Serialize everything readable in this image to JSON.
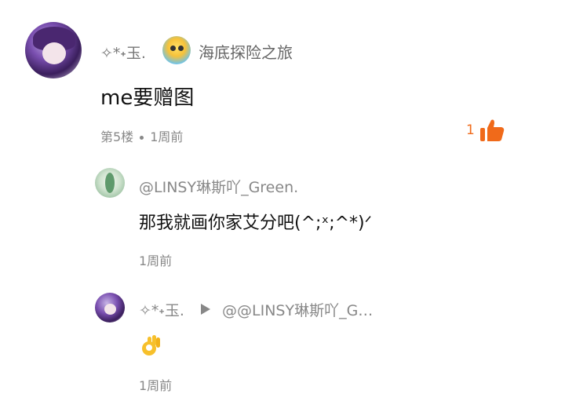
{
  "comment": {
    "author": "✧*˖玉.",
    "group_name": "海底探险之旅",
    "text": "me要赠图",
    "floor": "第5楼",
    "time": "1周前",
    "like_count": "1",
    "colors": {
      "like_accent": "#f06a1a"
    }
  },
  "replies": [
    {
      "author": "@LINSY琳斯吖_Green.",
      "text": "那我就画你家艾分吧(^;ˣ;^*)ᐟ",
      "time": "1周前"
    },
    {
      "author": "✧*˖玉.",
      "reply_to": "@@LINSY琳斯吖_G…",
      "text_icon": "ok-hand-emoji",
      "time": "1周前"
    }
  ]
}
